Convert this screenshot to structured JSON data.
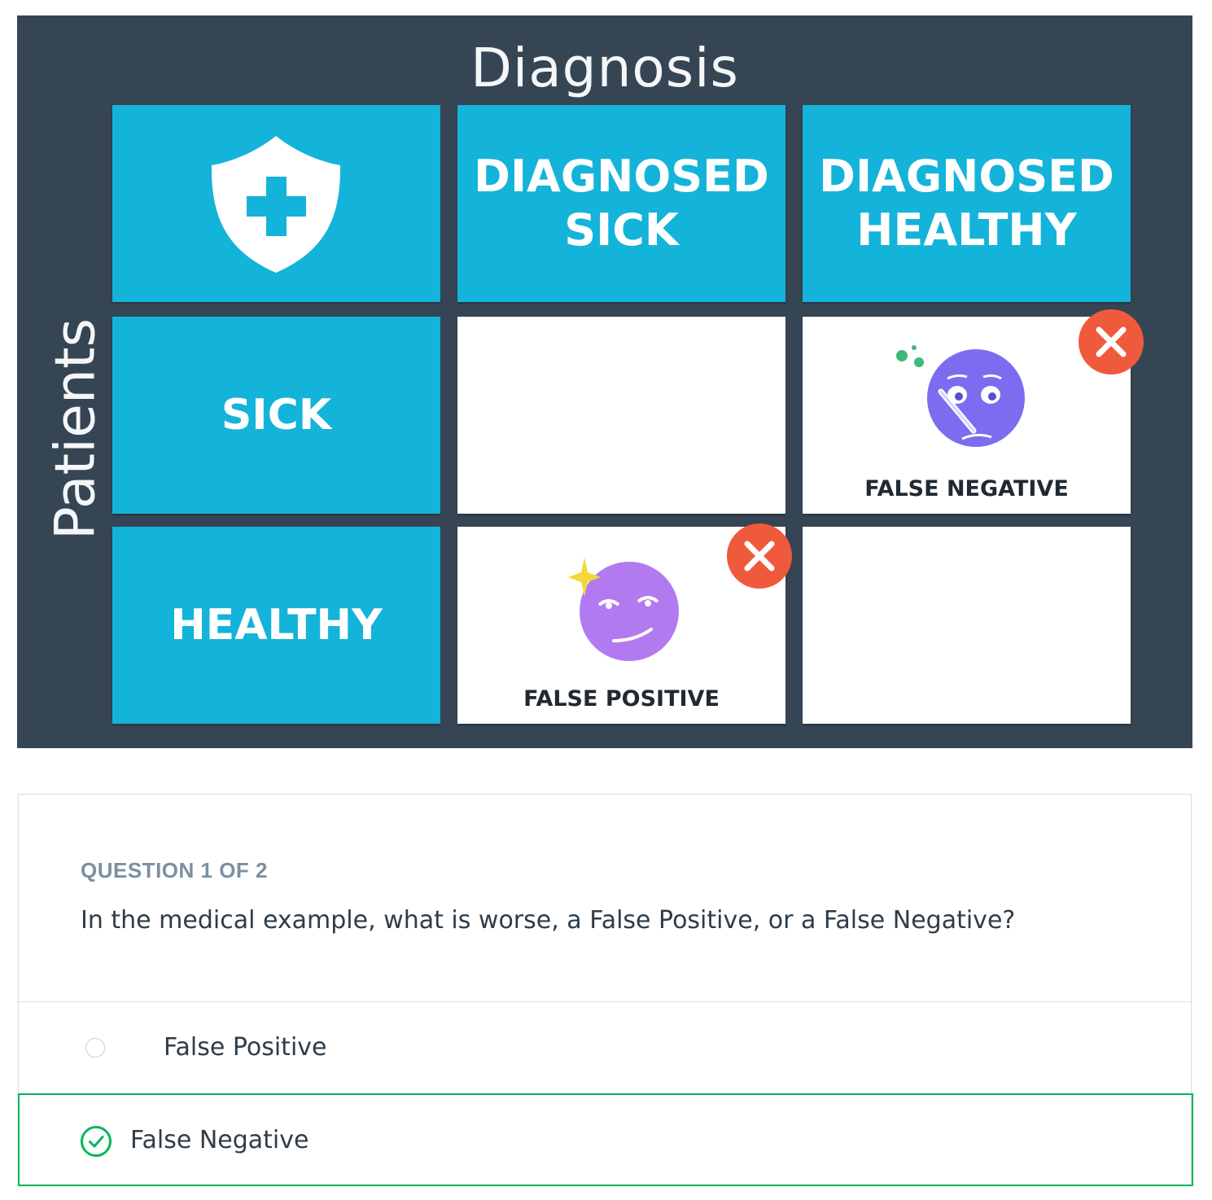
{
  "slide": {
    "title": "Diagnosis",
    "axis_label": "Patients",
    "headers": [
      "DIAGNOSED\nSICK",
      "DIAGNOSED\nHEALTHY"
    ],
    "rows": [
      "SICK",
      "HEALTHY"
    ],
    "false_negative_label": "FALSE NEGATIVE",
    "false_positive_label": "FALSE POSITIVE",
    "colors": {
      "background": "#364554",
      "tile": "#14b3d9",
      "x_badge": "#f05a3c",
      "emoji_sick": "#7b6cf0",
      "emoji_healthy": "#b27af0"
    },
    "icons": [
      "shield-plus-icon",
      "close-icon",
      "sick-face-icon",
      "smirk-face-icon",
      "sparkle-icon"
    ]
  },
  "quiz": {
    "counter": "QUESTION 1 OF 2",
    "question": "In the medical example, what is worse, a False Positive, or a False Negative?",
    "options": [
      {
        "label": "False Positive",
        "selected": false
      },
      {
        "label": "False Negative",
        "selected": true,
        "correct": true
      }
    ],
    "colors": {
      "correct": "#02b65a",
      "text": "#2e3d49",
      "muted": "#7d8fa1"
    }
  }
}
